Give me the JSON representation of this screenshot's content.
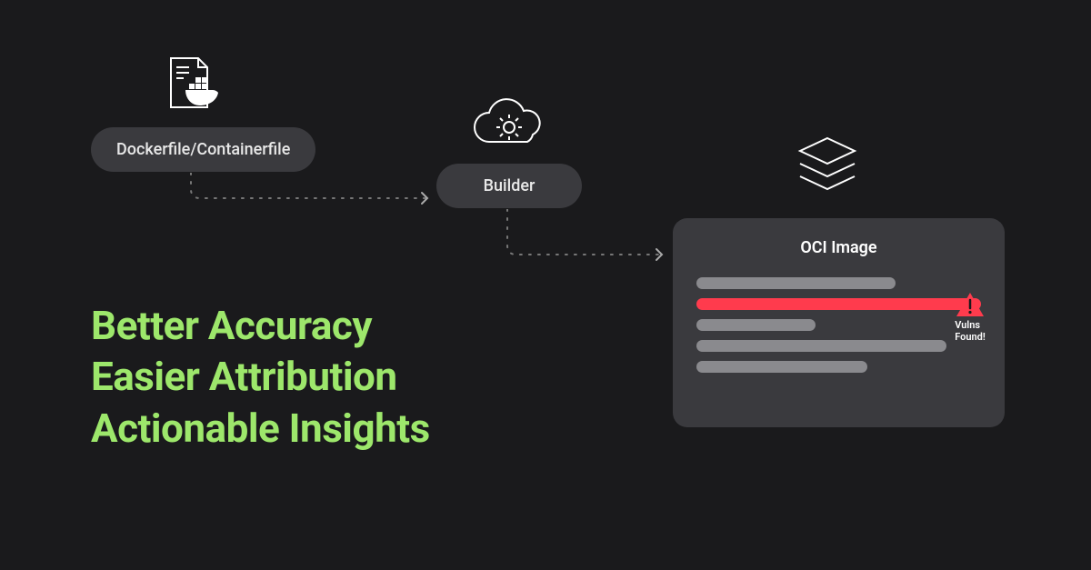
{
  "nodes": {
    "dockerfile": {
      "label": "Dockerfile/Containerfile"
    },
    "builder": {
      "label": "Builder"
    },
    "oci": {
      "title": "OCI Image"
    }
  },
  "vuln_badge": {
    "line1": "Vulns",
    "line2": "Found!"
  },
  "headline": {
    "line1": "Better Accuracy",
    "line2": "Easier Attribution",
    "line3": "Actionable Insights"
  },
  "colors": {
    "bg": "#1a1a1c",
    "pill": "#3a3a3e",
    "accent": "#9de76b",
    "vuln": "#ff3b4d"
  }
}
